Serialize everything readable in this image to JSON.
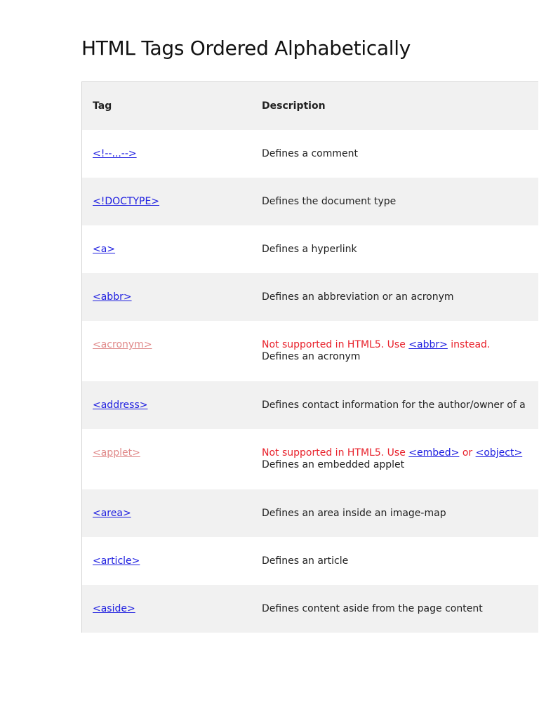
{
  "title": "HTML Tags Ordered Alphabetically",
  "table": {
    "headers": {
      "tag": "Tag",
      "description": "Description"
    },
    "rows": [
      {
        "tag": "<!--...-->",
        "description": "Defines a comment"
      },
      {
        "tag": "<!DOCTYPE>",
        "description": "Defines the document type"
      },
      {
        "tag": "<a>",
        "description": "Defines a hyperlink"
      },
      {
        "tag": "<abbr>",
        "description": "Defines an abbreviation or an acronym"
      },
      {
        "tag": "<acronym>",
        "deprecated": true,
        "warning": {
          "prefix": "Not supported in HTML5. Use ",
          "link1": "<abbr>",
          "mid": " instead."
        },
        "description": "Defines an acronym"
      },
      {
        "tag": "<address>",
        "description": "Defines contact information for the author/owner of a"
      },
      {
        "tag": "<applet>",
        "deprecated": true,
        "warning": {
          "prefix": "Not supported in HTML5. Use ",
          "link1": "<embed>",
          "mid": " or ",
          "link2": "<object>"
        },
        "description": "Defines an embedded applet"
      },
      {
        "tag": "<area>",
        "description": "Defines an area inside an image-map"
      },
      {
        "tag": "<article>",
        "description": "Defines an article"
      },
      {
        "tag": "<aside>",
        "description": "Defines content aside from the page content"
      }
    ]
  },
  "colors": {
    "link": "#2020e0",
    "deprecated_link": "#e08a8a",
    "warning": "#e8202a",
    "alt_row": "#f1f1f1"
  }
}
